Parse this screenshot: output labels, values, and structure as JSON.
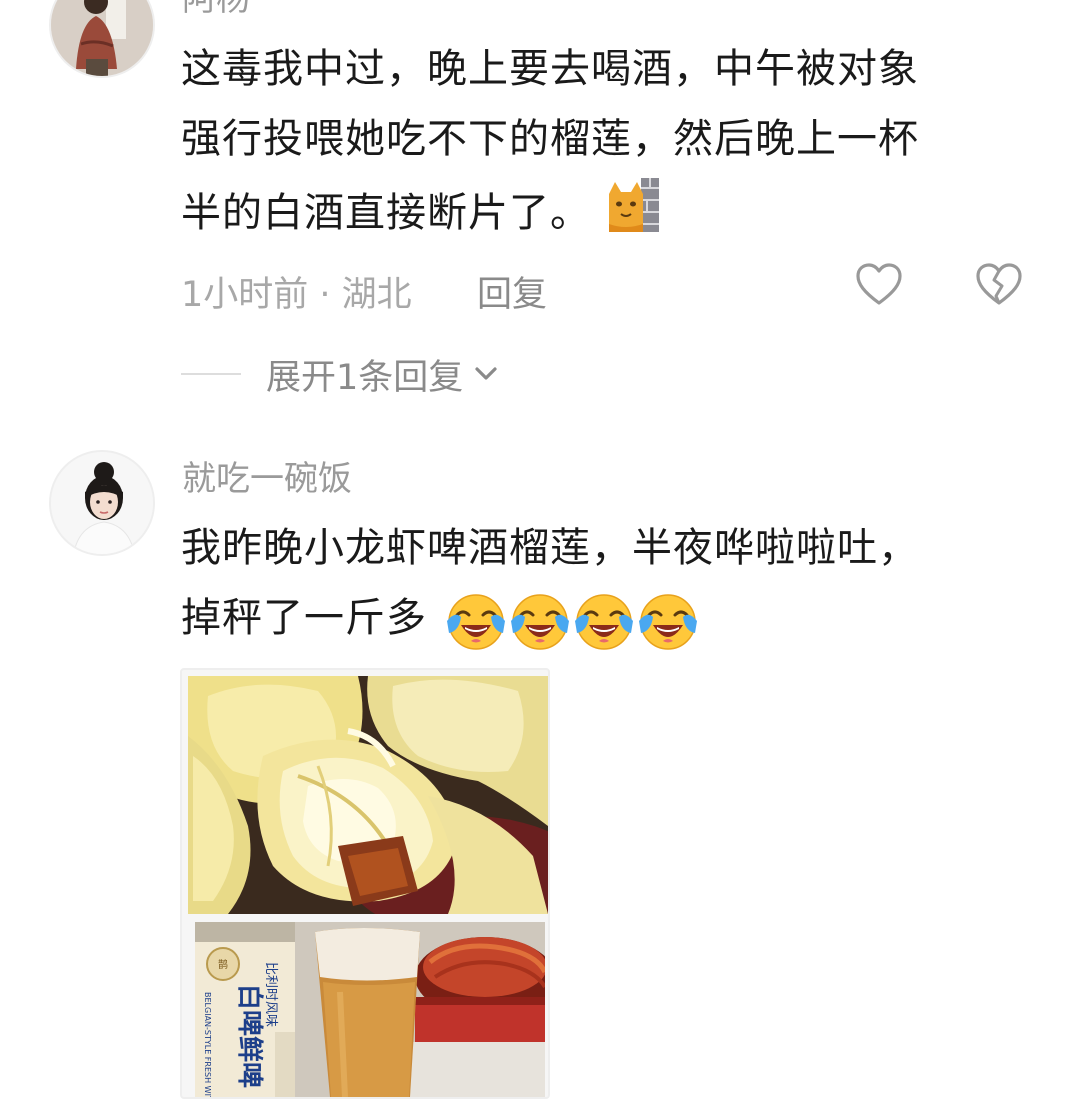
{
  "comments": [
    {
      "username": "阿杨",
      "text_lines": [
        "这毒我中过，晚上要去喝酒，中午被对象",
        "强行投喂她吃不下的榴莲，然后晚上一杯",
        "半的白酒直接断片了。"
      ],
      "emoji": "cat-behind-wall-emoji",
      "time": "1小时前",
      "location": "湖北",
      "meta_separator": " · ",
      "reply_label": "回复",
      "like_icon": "heart-outline-icon",
      "dislike_icon": "broken-heart-icon",
      "expand_label": "展开1条回复"
    },
    {
      "username": "就吃一碗饭",
      "text_lines": [
        "我昨晚小龙虾啤酒榴莲，半夜哗啦啦吐，",
        "掉秤了一斤多"
      ],
      "emoji": "crying-laughing-face-emoji",
      "emoji_count": 4,
      "photo": {
        "top_image": "durian-flesh-photo",
        "bottom_image": "beer-and-crayfish-photo",
        "can_label_lines": [
          "比利时风味",
          "白啤鲜啤"
        ],
        "can_small_label": "BELGIAN-STYLE FRESH WITBIER"
      }
    }
  ],
  "colors": {
    "text_primary": "#1a1a1a",
    "text_secondary": "#a8a8a8",
    "icon_gray": "#999999"
  }
}
